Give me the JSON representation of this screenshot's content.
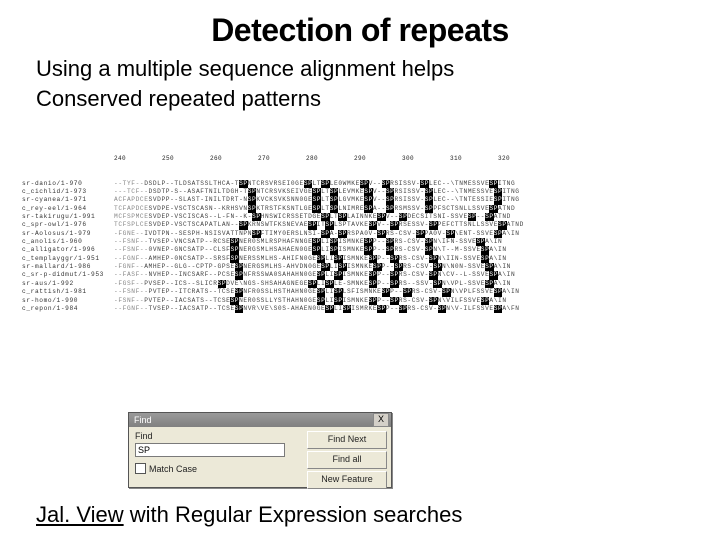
{
  "title": "Detection of repeats",
  "subtitle1": "Using a multiple sequence alignment helps",
  "subtitle2": "Conserved repeated patterns",
  "ruler_ticks": [
    "240",
    "250",
    "260",
    "270",
    "280",
    "290",
    "300",
    "310",
    "320"
  ],
  "sequences": [
    {
      "id": "sr-danio/1-970",
      "pre": "--TYF--",
      "a": "DSDLP--TLDSATSSLTHCA-T",
      "sp1": "SP",
      "b": "NTCRSVRSEI0GE",
      "sp2": "SP",
      "c": "LT",
      "sp3": "SP",
      "d": "LE0WMKE",
      "sp4": "SP",
      "e": "V--",
      "sp5": "SP",
      "f": "RSISSV-",
      "sp6": "SP",
      "g": "LEC--\\TNMESSVE",
      "sp7": "SP",
      "h": "ITNG"
    },
    {
      "id": "c_cichlid/1-973",
      "pre": "---TCF--",
      "a": "DSDTP-S--ASAFTNILTDGH-T",
      "sp1": "SP",
      "b": "NTCRSVKSEIVGE",
      "sp2": "SP",
      "c": "LT",
      "sp3": "SP",
      "d": "LEVMKE",
      "sp4": "SP",
      "e": "V--",
      "sp5": "SP",
      "f": "RSISSV-",
      "sp6": "SP",
      "g": "LEC--\\TNMESSVE",
      "sp7": "SP",
      "h": "ITNG"
    },
    {
      "id": "sr-cyanea/1-971",
      "pre": "ACFAPDCE",
      "a": "SVDPP--SLAST-INILTDRT-N",
      "sp1": "SP",
      "b": "KVCKSVKSNN0GE",
      "sp2": "SP",
      "c": "LT",
      "sp3": "SP",
      "d": "LGVMKE",
      "sp4": "SP",
      "e": "V--",
      "sp5": "SP",
      "f": "RSISSV-",
      "sp6": "SP",
      "g": "LEC--\\TNTESSIE",
      "sp7": "SP",
      "h": "ITNG"
    },
    {
      "id": "c_rey-eel/1-964",
      "pre": "TCFAPDCE",
      "a": "SVDPE-VSCTSCASN--KRHSVN",
      "sp1": "SP",
      "b": "KTRSTFKSNTLGE",
      "sp2": "SP",
      "c": "LT",
      "sp3": "SP",
      "d": "LNIMRE",
      "sp4": "SP",
      "e": "A--",
      "sp5": "SP",
      "f": "RSMSSV-",
      "sp6": "SP",
      "g": "PFSCTSNLLSSVE",
      "sp7": "SP",
      "h": "ATND"
    },
    {
      "id": "sr-takirugu/1-991",
      "pre": "MCFSPMCE",
      "a": "SVDEP-VSCISCAS--L-FN--K-",
      "sp1": "SP",
      "b": "HNSWICRSSETDGE",
      "sp2": "SP",
      "c": "LT",
      "sp3": "SP",
      "d": "LAINNKE",
      "sp4": "SP",
      "e": "V--",
      "sp5": "SP",
      "f": "DECSITSNI-SSVE",
      "sp6": "SP",
      "g": "--",
      "sp7": "SP",
      "h": "ATND"
    },
    {
      "id": "c_spr-owl/1-976",
      "pre": "TCFSPLCE",
      "a": "SVDEP-VSCTSCAPATLAN--",
      "sp1": "SP",
      "b": "KRNSWTFKSNEVAE",
      "sp2": "SP",
      "c": "IT",
      "sp3": "SP",
      "d": "LSPTAVKE",
      "sp4": "SP",
      "e": "V--",
      "sp5": "SP",
      "f": "RSESSV-",
      "sp6": "SP",
      "g": "PEFCTTSNLLSSVE",
      "sp7": "SP",
      "h": "ATND"
    },
    {
      "id": "sr-Aolosus/1-979",
      "pre": "-FGNE--",
      "a": "IVDTPN--SESPH-NSISVATTNPN",
      "sp1": "SP",
      "b": "FTIMY0ERSLNSI-",
      "sp2": "SP",
      "c": "A-",
      "sp3": "SP",
      "d": "RSPA0V-",
      "sp4": "SP",
      "e": "RS-CSV-",
      "sp5": "SP",
      "f": "PA0V-",
      "sp6": "SP",
      "g": "\\ENT-SSVE",
      "sp7": "SP",
      "h": "A\\IN"
    },
    {
      "id": "c_anolis/1-960",
      "pre": "--FSNF--",
      "a": "TVSEP-VNCSATP--RCSE",
      "sp1": "SP",
      "b": "NER0SMLRSPHAFNNGE",
      "sp2": "SP",
      "c": "LI",
      "sp3": "SP",
      "d": "ISMNKE",
      "sp4": "SP",
      "e": "P--",
      "sp5": "SP",
      "f": "RS-CSV-",
      "sp6": "SP",
      "g": "N\\IFN-SSVE",
      "sp7": "SP",
      "h": "A\\IN"
    },
    {
      "id": "c_alligator/1-996",
      "pre": "--FSNF--",
      "a": "0VNEP-GNCSATP--CLSF",
      "sp1": "SP",
      "b": "NERGSMLHSAHAEN0GE",
      "sp2": "SP",
      "c": "LI",
      "sp3": "SP",
      "d": "ISMNKE",
      "sp4": "SP",
      "e": "P--",
      "sp5": "SP",
      "f": "RS-CSV-",
      "sp6": "SP",
      "g": "N\\T--M-SSVE",
      "sp7": "SP",
      "h": "A\\IN"
    },
    {
      "id": "c_templayggr/1-951",
      "pre": "--FGNF--",
      "a": "AMHEP-0NCSATP--SRSF",
      "sp1": "SP",
      "b": "NERSSMLHS-AHIFN0GE",
      "sp2": "SP",
      "c": "LI",
      "sp3": "SP",
      "d": "ISMNKE",
      "sp4": "SP",
      "e": "P--",
      "sp5": "SP",
      "f": "RS-CSV-",
      "sp6": "SP",
      "g": "N\\IIN-SSVE",
      "sp7": "SP",
      "h": "A\\IN"
    },
    {
      "id": "sr-mallard/1-986",
      "pre": "-FGNF--",
      "a": "AMHEP--GLG--CPTP-GPSE",
      "sp1": "SP",
      "b": "NERGSMLHS-AHVDN0GE",
      "sp2": "SP",
      "c": "LI",
      "sp3": "SP",
      "d": "ISMNKE",
      "sp4": "SP",
      "e": "P--",
      "sp5": "SP",
      "f": "RS-CSV-",
      "sp6": "SP",
      "g": "N\\N0N-SSVE",
      "sp7": "SP",
      "h": "A\\IN"
    },
    {
      "id": "c_sr-p-didmut/1-953",
      "pre": "--FASF--",
      "a": "NVHEP--INCSARF--PCSE",
      "sp1": "SP",
      "b": "NFRSSWA0SAHAHN0GE",
      "sp2": "SP",
      "c": "LI",
      "sp3": "SP",
      "d": "ISMNKE",
      "sp4": "SP",
      "e": "P--",
      "sp5": "SP",
      "f": "RS-CSV-",
      "sp6": "SP",
      "g": "N\\CV--L-SSVE",
      "sp7": "SP",
      "h": "A\\IN"
    },
    {
      "id": "sr-aus/1-992",
      "pre": "-FGSF--",
      "a": "PVSEP--ICS--SLICR",
      "sp1": "SP",
      "b": "DVE\\NGS-SHSAHAGNEGE",
      "sp2": "SP",
      "c": "LI",
      "sp3": "SP",
      "d": "LE-SMNKE",
      "sp4": "SP",
      "e": "P--",
      "sp5": "SP",
      "f": "RS--SSV-",
      "sp6": "SP",
      "g": "N\\VPL-SSVE",
      "sp7": "SP",
      "h": "A\\IN"
    },
    {
      "id": "c_rattish/1-981",
      "pre": "--FSNF--",
      "a": "PVTEP--ITCRATS--TCSE",
      "sp1": "SP",
      "b": "NFR0SSLHSTHAHN0GE",
      "sp2": "SP",
      "c": "LI",
      "sp3": "SP",
      "d": "LSFISMNKE",
      "sp4": "SP",
      "e": "P--",
      "sp5": "SP",
      "f": "RS-CSV-",
      "sp6": "SP",
      "g": "N\\VPLFSSVE",
      "sp7": "SP",
      "h": "A\\IN"
    },
    {
      "id": "sr-homo/1-990",
      "pre": "-FSNF--",
      "a": "PVTEP--IACSATS--TCSE",
      "sp1": "SP",
      "b": "NER0SSLLYSTHAHN0GE",
      "sp2": "SP",
      "c": "LI",
      "sp3": "SP",
      "d": "ISMNKE",
      "sp4": "SP",
      "e": "P--",
      "sp5": "SP",
      "f": "RS-CSV-",
      "sp6": "SP",
      "g": "N\\VILFSSVE",
      "sp7": "SP",
      "h": "A\\IN"
    },
    {
      "id": "c_repon/1-984",
      "pre": "--FGNF--",
      "a": "TVSEP--IACSATP--TCSE",
      "sp1": "SP",
      "b": "NVR\\VE\\S0S-AHAEN0GE",
      "sp2": "SP",
      "c": "LI",
      "sp3": "SP",
      "d": "ISMRKE",
      "sp4": "SP",
      "e": "P--",
      "sp5": "SP",
      "f": "RS-CSV-",
      "sp6": "SP",
      "g": "N\\V-ILFSSVE",
      "sp7": "SP",
      "h": "A\\FN"
    }
  ],
  "find_dialog": {
    "title": "Find",
    "close": "X",
    "label": "Find",
    "input_value": "SP",
    "match_case": "Match Case",
    "buttons": [
      "Find Next",
      "Find all",
      "New Feature"
    ]
  },
  "footer_underlined": "Jal. View",
  "footer_rest": " with Regular Expression searches"
}
